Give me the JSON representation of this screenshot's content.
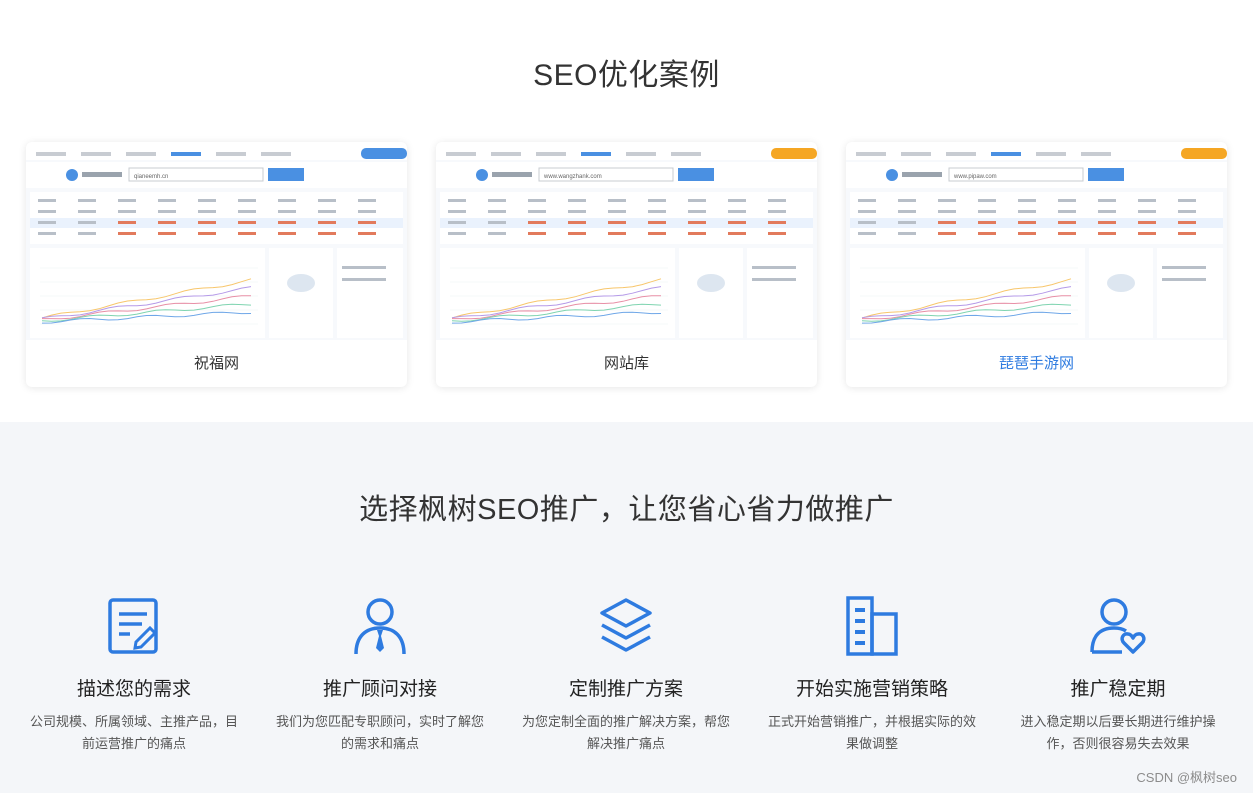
{
  "sections": {
    "cases_title": "SEO优化案例",
    "process_title": "选择枫树SEO推广，让您省心省力做推广"
  },
  "cases": [
    {
      "caption": "祝福网",
      "domain": "qianeemh.cn",
      "badge_color": "#4a90e2",
      "active": false
    },
    {
      "caption": "网站库",
      "domain": "www.wangzhank.com",
      "badge_color": "#f5a623",
      "active": false
    },
    {
      "caption": "琵琶手游网",
      "domain": "www.pipaw.com",
      "badge_color": "#f5a623",
      "active": true
    }
  ],
  "steps": [
    {
      "icon": "document-edit-icon",
      "title": "描述您的需求",
      "desc": "公司规模、所属领域、主推产品，目前运营推广的痛点"
    },
    {
      "icon": "consultant-icon",
      "title": "推广顾问对接",
      "desc": "我们为您匹配专职顾问，实时了解您的需求和痛点"
    },
    {
      "icon": "layers-icon",
      "title": "定制推广方案",
      "desc": "为您定制全面的推广解决方案，帮您解决推广痛点"
    },
    {
      "icon": "buildings-icon",
      "title": "开始实施营销策略",
      "desc": "正式开始营销推广，并根据实际的效果做调整"
    },
    {
      "icon": "user-heart-icon",
      "title": "推广稳定期",
      "desc": "进入稳定期以后要长期进行维护操作，否则很容易失去效果"
    }
  ],
  "accent": "#2e7be0",
  "watermark": "CSDN @枫树seo"
}
